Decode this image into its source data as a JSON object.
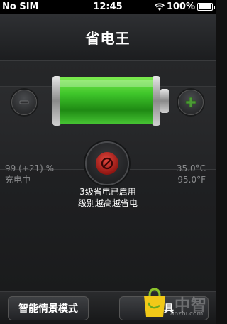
{
  "status_bar": {
    "carrier": "No SIM",
    "time": "12:45",
    "battery_percent": "100%"
  },
  "header": {
    "title": "省电王"
  },
  "battery": {
    "level": 1.0,
    "color": "#3ec52a"
  },
  "stats": {
    "charge": "99 (+21) %",
    "charge_status": "充电中",
    "temp_c": "35.0°C",
    "temp_f": "95.0°F"
  },
  "power_saving": {
    "line1": "3级省电已启用",
    "line2": "级别越高越省电"
  },
  "bottom_bar": {
    "smart_mode_label": "智能情景模式",
    "tools_label": "工具"
  },
  "watermark": {
    "text": "中智",
    "url": "anzhi.com"
  },
  "icons": {
    "decrease": "minus-icon",
    "increase": "plus-icon",
    "power": "power-icon"
  }
}
